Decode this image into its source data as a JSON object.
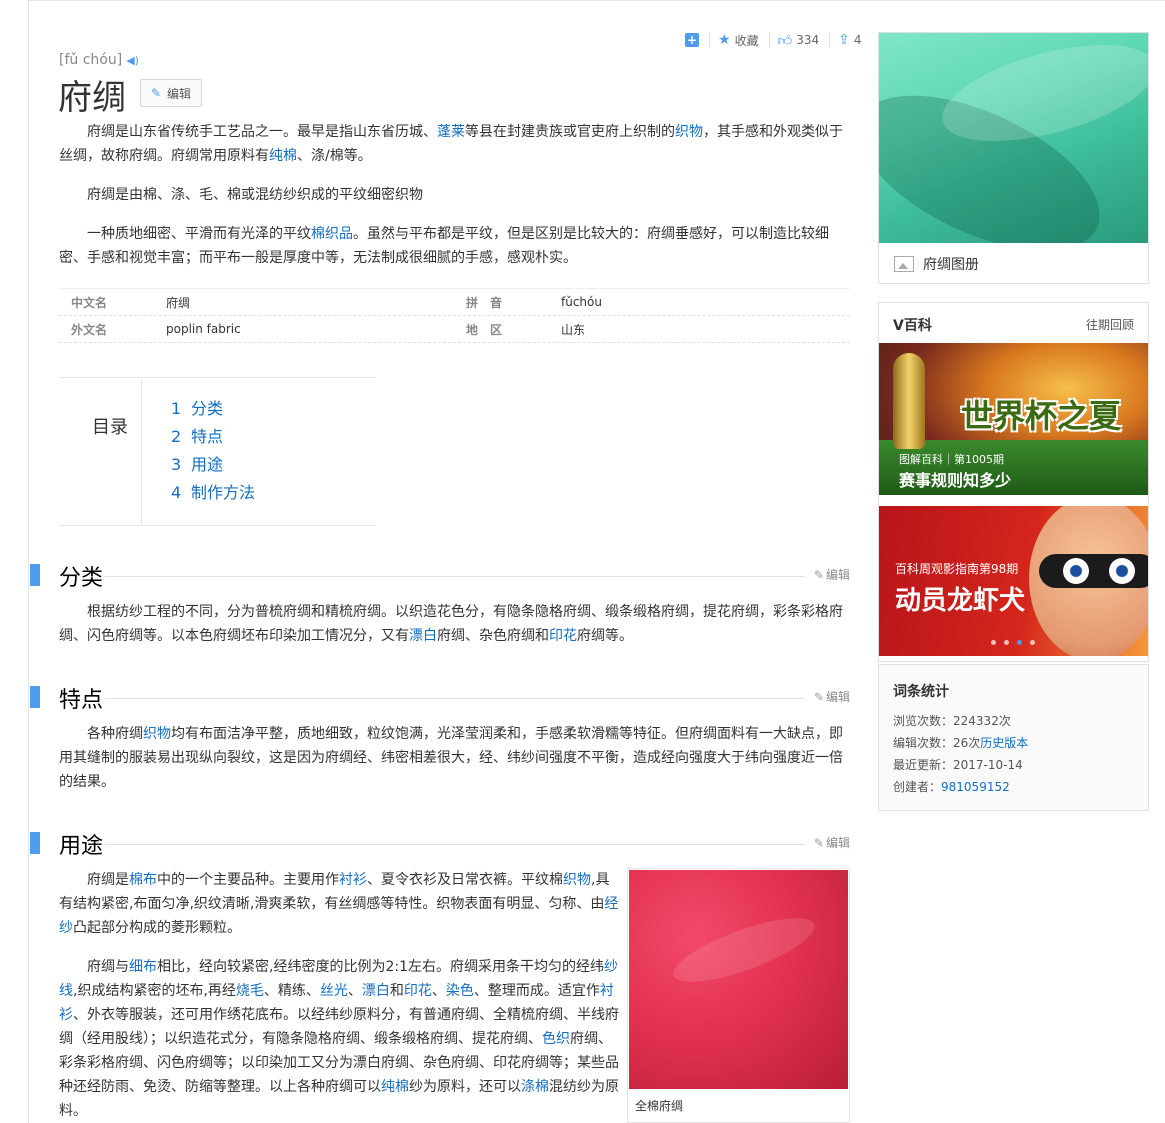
{
  "toolbar": {
    "favorite_label": "收藏",
    "like_count": "334",
    "share_count": "4"
  },
  "entry": {
    "pinyin": "[fǔ chóu]",
    "title": "府绸",
    "edit_label": "编辑"
  },
  "intro": {
    "p1_a": "府绸是山东省传统手工艺品之一。最早是指山东省历城、",
    "p1_link1": "蓬莱",
    "p1_b": "等县在封建贵族或官吏府上织制的",
    "p1_link2": "织物",
    "p1_c": "，其手感和外观类似于丝绸，故称府绸。府绸常用原料有",
    "p1_link3": "纯棉",
    "p1_d": "、涤/棉等。",
    "p2": "府绸是由棉、涤、毛、棉或混纺纱织成的平纹细密织物",
    "p3_a": "一种质地细密、平滑而有光泽的平纹",
    "p3_link": "棉织品",
    "p3_b": "。虽然与平布都是平纹，但是区别是比较大的：府绸垂感好，可以制造比较细密、手感和视觉丰富；而平布一般是厚度中等，无法制成很细腻的手感，感观朴实。"
  },
  "infobox": {
    "rows": [
      {
        "k1": "中文名",
        "v1": "府绸",
        "k2": "拼音",
        "v2": "fǔchóu"
      },
      {
        "k1": "外文名",
        "v1": "poplin fabric",
        "k2": "地区",
        "v2": "山东"
      }
    ]
  },
  "catalog": {
    "label": "目录",
    "items": [
      {
        "num": "1",
        "label": "分类"
      },
      {
        "num": "2",
        "label": "特点"
      },
      {
        "num": "3",
        "label": "用途"
      },
      {
        "num": "4",
        "label": "制作方法"
      }
    ]
  },
  "sections": {
    "edit_label": "编辑",
    "s1": {
      "title": "分类",
      "a": "根据纺纱工程的不同，分为普梳府绸和精梳府绸。以织造花色分，有隐条隐格府绸、缎条缎格府绸，提花府绸，彩条彩格府绸、闪色府绸等。以本色府绸坯布印染加工情况分，又有",
      "link1": "漂白",
      "b": "府绸、杂色府绸和",
      "link2": "印花",
      "c": "府绸等。"
    },
    "s2": {
      "title": "特点",
      "a": "各种府绸",
      "link1": "织物",
      "b": "均有布面洁净平整，质地细致，粒纹饱满，光泽莹润柔和，手感柔软滑糯等特征。但府绸面料有一大缺点，即用其缝制的服装易出现纵向裂纹，这是因为府绸经、纬密相差很大，经、纬纱间强度不平衡，造成经向强度大于纬向强度近一倍的结果。"
    },
    "s3": {
      "title": "用途",
      "p1_a": "府绸是",
      "p1_l1": "棉布",
      "p1_b": "中的一个主要品种。主要用作",
      "p1_l2": "衬衫",
      "p1_c": "、夏令衣衫及日常衣裤。平纹棉",
      "p1_l3": "织物",
      "p1_d": ",具有结构紧密,布面匀净,织纹清晰,滑爽柔软，有丝绸感等特性。织物表面有明显、匀称、由",
      "p1_l4": "经纱",
      "p1_e": "凸起部分构成的菱形颗粒。",
      "p2_a": "府绸与",
      "p2_l1": "细布",
      "p2_b": "相比，经向较紧密,经纬密度的比例为2:1左右。府绸采用条干均匀的经纬",
      "p2_l2": "纱线",
      "p2_c": ",织成结构紧密的坯布,再经",
      "p2_l3": "烧毛",
      "p2_d": "、精练、",
      "p2_l4": "丝光",
      "p2_e": "、",
      "p2_l5": "漂白",
      "p2_f": "和",
      "p2_l6": "印花",
      "p2_g": "、",
      "p2_l7": "染色",
      "p2_h": "、整理而成。适宜作",
      "p2_l8": "衬衫",
      "p2_i": "、外衣等服装，还可用作绣花底布。以经纬纱原料分，有普通府绸、全精梳府绸、半线府绸（经用股线）；以织造花式分，有隐条隐格府绸、缎条缎格府绸、提花府绸、",
      "p2_l9": "色织",
      "p2_j": "府绸、彩条彩格府绸、闪色府绸等；以印染加工又分为漂白府绸、杂色府绸、印花府绸等；某些品种还经防雨、免烫、防缩等整理。以上各种府绸可以",
      "p2_l10": "纯棉",
      "p2_k": "纱为原料，还可以",
      "p2_l11": "涤棉",
      "p2_m": "混纺纱为原料。",
      "figure_caption": "全棉府绸"
    }
  },
  "sidebar": {
    "album_label": "府绸图册",
    "vbaike": {
      "title": "V百科",
      "more": "往期回顾",
      "banner1_big": "世界杯之夏",
      "banner1_small": "图解百科｜第1005期",
      "banner1_sub": "赛事规则知多少",
      "banner2_small": "百科周观影指南第98期",
      "banner2_big": "动员龙虾犬"
    },
    "stats": {
      "title": "词条统计",
      "views_label": "浏览次数：",
      "views": "224332次",
      "edits_label": "编辑次数：",
      "edits": "26次",
      "history_link": "历史版本",
      "updated_label": "最近更新：",
      "updated": "2017-10-14",
      "creator_label": "创建者：",
      "creator": "981059152"
    }
  }
}
